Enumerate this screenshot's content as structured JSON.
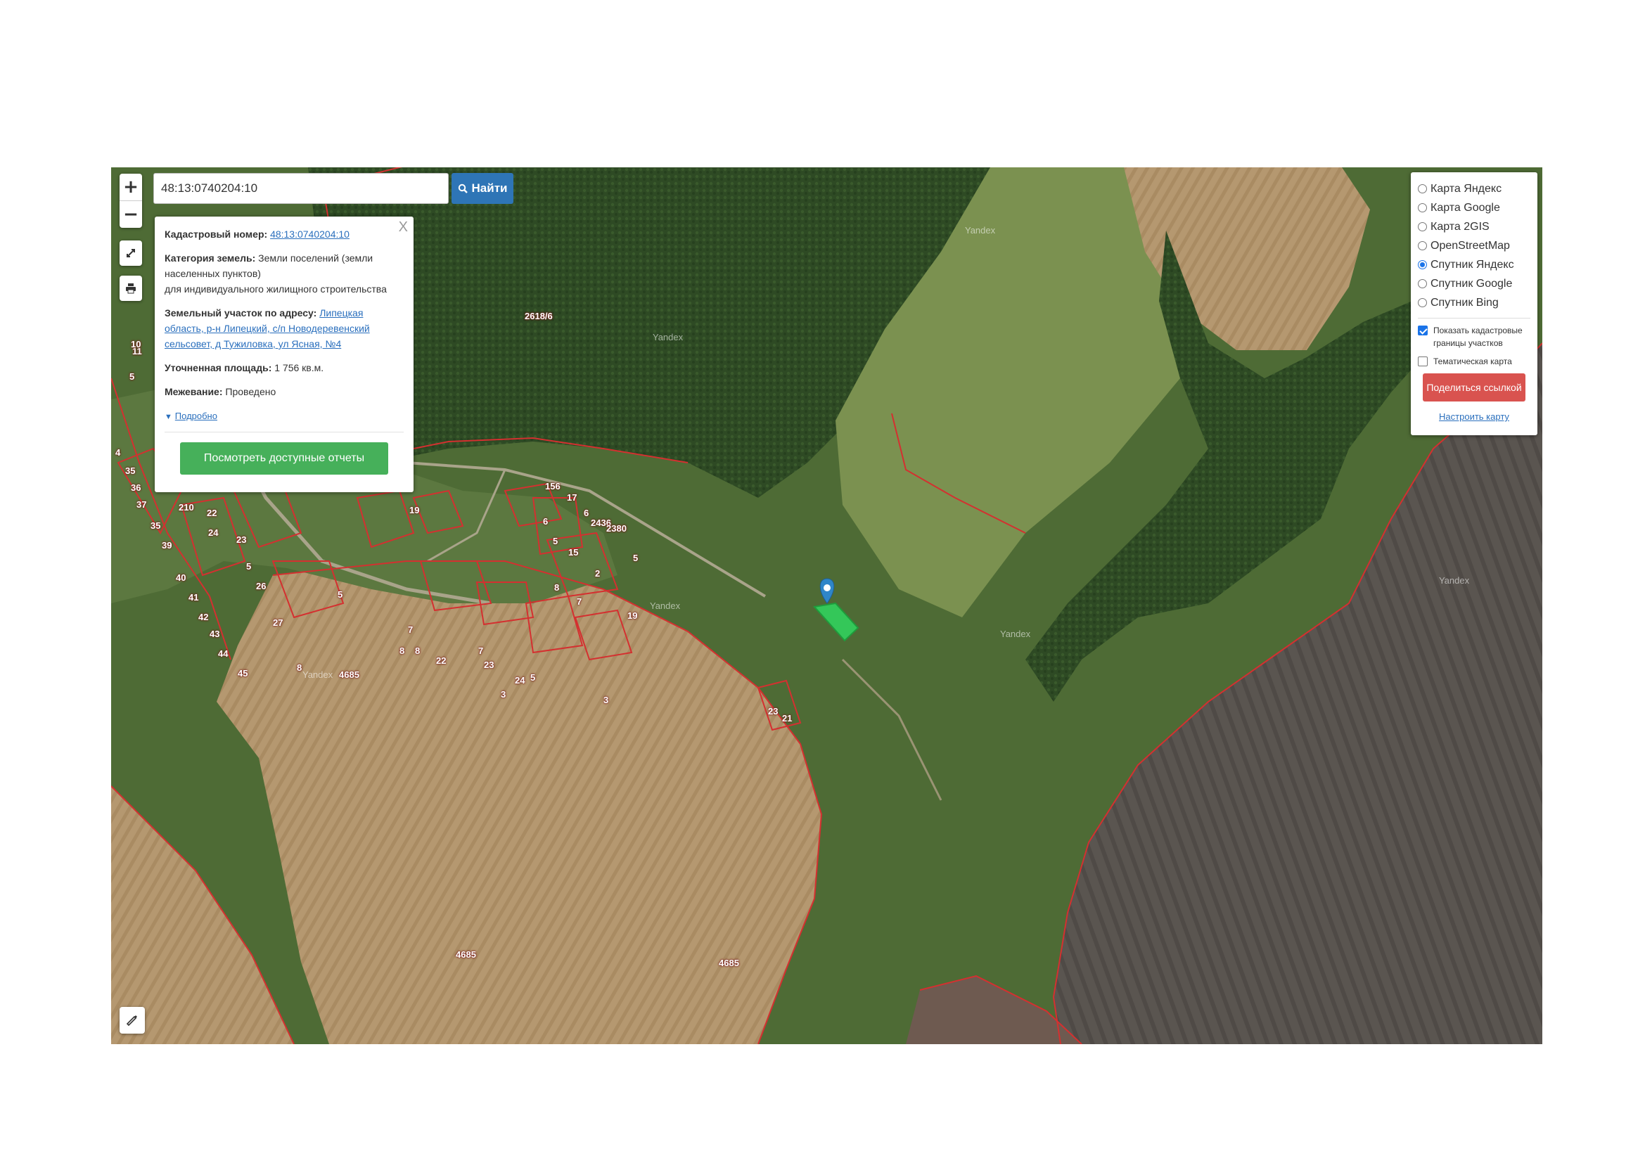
{
  "search": {
    "value": "48:13:0740204:10",
    "button_label": "Найти"
  },
  "zoom": {
    "in": "+",
    "out": "−"
  },
  "popup": {
    "cadastral_label": "Кадастровый номер:",
    "cadastral_value": "48:13:0740204:10",
    "category_label": "Категория земель:",
    "category_value": "Земли поселений (земли населенных пунктов)",
    "category_use": "для индивидуального жилищного строительства",
    "address_label": "Земельный участок по адресу:",
    "address_value": "Липецкая область, р-н Липецкий, с/п Новодеревенский сельсовет, д Тужиловка, ул Ясная, №4",
    "area_label": "Уточненная площадь:",
    "area_value": "1 756 кв.м.",
    "survey_label": "Межевание:",
    "survey_value": "Проведено",
    "more_label": "Подробно",
    "report_button": "Посмотреть доступные отчеты",
    "close": "X"
  },
  "layers": {
    "options": [
      {
        "label": "Карта Яндекс",
        "selected": false
      },
      {
        "label": "Карта Google",
        "selected": false
      },
      {
        "label": "Карта 2GIS",
        "selected": false
      },
      {
        "label": "OpenStreetMap",
        "selected": false
      },
      {
        "label": "Спутник Яндекс",
        "selected": true
      },
      {
        "label": "Спутник Google",
        "selected": false
      },
      {
        "label": "Спутник Bing",
        "selected": false
      }
    ],
    "show_cadastral": {
      "label": "Показать кадастровые границы участков",
      "checked": true
    },
    "thematic": {
      "label": "Тематическая карта",
      "checked": false
    },
    "share_button": "Поделиться ссылкой",
    "configure_link": "Настроить карту"
  },
  "map_labels": [
    "2618/6",
    "4685",
    "4685",
    "4685",
    "156",
    "17",
    "2436",
    "2380",
    "5",
    "6",
    "5",
    "19",
    "15",
    "2",
    "8",
    "7",
    "5",
    "19",
    "6",
    "3",
    "210",
    "22",
    "35",
    "23",
    "24",
    "39",
    "40",
    "41",
    "42",
    "43",
    "44",
    "45",
    "26",
    "27",
    "5",
    "7",
    "8",
    "22",
    "23",
    "3",
    "5",
    "8",
    "23",
    "21",
    "24",
    "35",
    "36",
    "37",
    "11",
    "5",
    "4",
    "10",
    "8",
    "7"
  ],
  "watermark": "Yandex",
  "colors": {
    "parcel_border": "#d43030",
    "selected_parcel": "#34c759",
    "marker": "#2f86c9",
    "find_button": "#2e75b6",
    "report_button": "#46b05a",
    "share_button": "#d9534f"
  }
}
